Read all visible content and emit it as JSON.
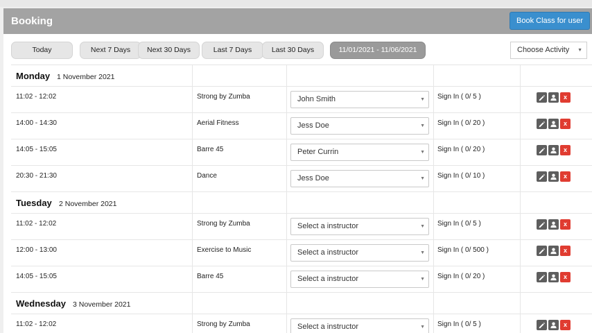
{
  "header": {
    "title": "Booking",
    "book_button": "Book Class for user",
    "accent": "#3a8fce"
  },
  "filters": [
    {
      "label": "Today",
      "active": false
    },
    {
      "label": "Next 7 Days",
      "active": false
    },
    {
      "label": "Next 30 Days",
      "active": false
    },
    {
      "label": "Last 7 Days",
      "active": false
    },
    {
      "label": "Last 30 Days",
      "active": false
    },
    {
      "label": "11/01/2021 - 11/06/2021",
      "active": true
    }
  ],
  "activity_select": {
    "value": "Choose Activity"
  },
  "days": [
    {
      "name": "Monday",
      "date": "1 November 2021",
      "sessions": [
        {
          "time": "11:02 - 12:02",
          "class": "Strong by Zumba",
          "instructor": "John Smith",
          "signin": "Sign In ( 0/ 5 )"
        },
        {
          "time": "14:00 - 14:30",
          "class": "Aerial Fitness",
          "instructor": "Jess Doe",
          "signin": "Sign In ( 0/ 20 )"
        },
        {
          "time": "14:05 - 15:05",
          "class": "Barre 45",
          "instructor": "Peter Currin",
          "signin": "Sign In ( 0/ 20 )"
        },
        {
          "time": "20:30 - 21:30",
          "class": "Dance",
          "instructor": "Jess Doe",
          "signin": "Sign In ( 0/ 10 )"
        }
      ]
    },
    {
      "name": "Tuesday",
      "date": "2 November 2021",
      "sessions": [
        {
          "time": "11:02 - 12:02",
          "class": "Strong by Zumba",
          "instructor": "Select a instructor",
          "signin": "Sign In ( 0/ 5 )"
        },
        {
          "time": "12:00 - 13:00",
          "class": "Exercise to Music",
          "instructor": "Select a instructor",
          "signin": "Sign In ( 0/ 500 )"
        },
        {
          "time": "14:05 - 15:05",
          "class": "Barre 45",
          "instructor": "Select a instructor",
          "signin": "Sign In ( 0/ 20 )"
        }
      ]
    },
    {
      "name": "Wednesday",
      "date": "3 November 2021",
      "sessions": [
        {
          "time": "11:02 - 12:02",
          "class": "Strong by Zumba",
          "instructor": "Select a instructor",
          "signin": "Sign In ( 0/ 5 )"
        }
      ]
    }
  ],
  "icons": {
    "edit": "pencil-icon",
    "user": "user-icon",
    "delete": "x"
  }
}
